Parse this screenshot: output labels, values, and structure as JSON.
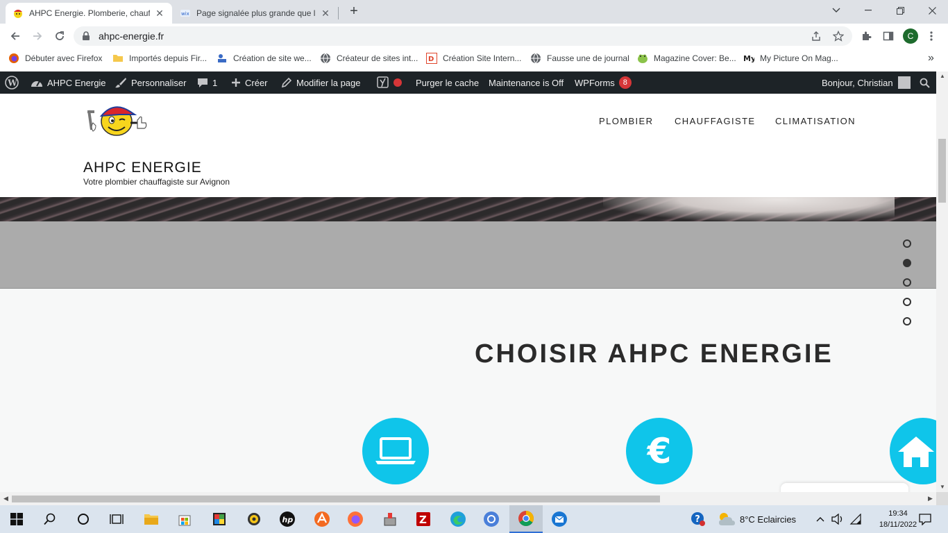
{
  "browser": {
    "tabs": [
      {
        "title": "AHPC Energie. Plomberie, chauff",
        "active": true
      },
      {
        "title": "Page signalée plus grande que la",
        "active": false
      }
    ],
    "url": "ahpc-energie.fr",
    "profile_initial": "C",
    "bookmarks": [
      {
        "label": "Débuter avec Firefox",
        "icon": "firefox-icon"
      },
      {
        "label": "Importés depuis Fir...",
        "icon": "folder-icon"
      },
      {
        "label": "Création de site we...",
        "icon": "site-icon"
      },
      {
        "label": "Créateur de sites int...",
        "icon": "globe-icon"
      },
      {
        "label": "Création Site Intern...",
        "icon": "d-icon"
      },
      {
        "label": "Fausse une de journal",
        "icon": "globe-icon"
      },
      {
        "label": "Magazine Cover: Be...",
        "icon": "frog-icon"
      },
      {
        "label": "My Picture On Mag...",
        "icon": "my-icon"
      }
    ],
    "more_bookmarks": "»"
  },
  "wp_admin_bar": {
    "site": "AHPC Energie",
    "customize": "Personnaliser",
    "comments_count": "1",
    "new": "Créer",
    "edit_page": "Modifier la page",
    "purge_cache": "Purger le cache",
    "maintenance": "Maintenance is Off",
    "wpforms": "WPForms",
    "wpforms_count": "8",
    "greeting": "Bonjour, Christian"
  },
  "site": {
    "title": "AHPC ENERGIE",
    "tagline": "Votre plombier chauffagiste sur Avignon",
    "nav": [
      "PLOMBIER",
      "CHAUFFAGISTE",
      "CLIMATISATION"
    ],
    "section_title": "CHOISIR AHPC ENERGIE",
    "euro_symbol": "€",
    "slider_active_index": 1,
    "slider_count": 5
  },
  "taskbar": {
    "weather": "8°C  Eclaircies",
    "time": "19:34",
    "date": "18/11/2022"
  },
  "colors": {
    "wp_bar": "#1d2327",
    "accent_cyan": "#0fc5ea",
    "badge_red": "#d63638"
  }
}
